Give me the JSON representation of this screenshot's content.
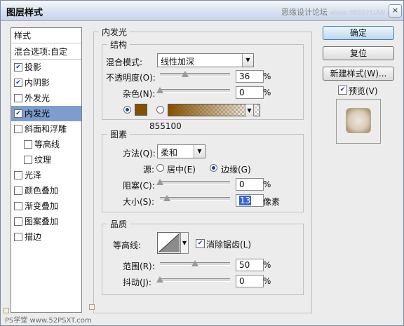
{
  "window": {
    "title": "图层样式",
    "close_glyph": "×"
  },
  "watermark": {
    "text": "思缘设计论坛",
    "site": "www.MISSYUAN.com"
  },
  "left_panel": {
    "header": "样式",
    "blend_options": "混合选项:自定",
    "items": [
      {
        "label": "投影",
        "checked": true
      },
      {
        "label": "内阴影",
        "checked": true
      },
      {
        "label": "外发光",
        "checked": false
      },
      {
        "label": "内发光",
        "checked": true,
        "selected": true
      },
      {
        "label": "斜面和浮雕",
        "checked": false
      },
      {
        "label": "等高线",
        "checked": false
      },
      {
        "label": "纹理",
        "checked": false
      },
      {
        "label": "光泽",
        "checked": false
      },
      {
        "label": "颜色叠加",
        "checked": false
      },
      {
        "label": "渐变叠加",
        "checked": false
      },
      {
        "label": "图案叠加",
        "checked": false
      },
      {
        "label": "描边",
        "checked": false
      }
    ]
  },
  "inner_glow": {
    "title": "内发光",
    "structure": {
      "title": "结构",
      "blend_mode_label": "混合模式:",
      "blend_mode_value": "线性加深",
      "opacity_label": "不透明度(O):",
      "opacity_value": "36",
      "opacity_level": 0.36,
      "noise_label": "杂色(N):",
      "noise_value": "0",
      "noise_level": 0,
      "percent_unit": "%",
      "glow_color": "#855100",
      "glow_color_text": "855100"
    },
    "elements": {
      "title": "图素",
      "technique_label": "方法(Q):",
      "technique_value": "柔和",
      "source_label": "源:",
      "source_center": "居中(E)",
      "source_edge": "边缘(G)",
      "choke_label": "阻塞(C):",
      "choke_value": "0",
      "choke_level": 0,
      "size_label": "大小(S):",
      "size_value": "13",
      "size_unit": "像素"
    },
    "quality": {
      "title": "品质",
      "contour_label": "等高线:",
      "anti_alias_label": "消除锯齿(L)",
      "range_label": "范围(R):",
      "range_value": "50",
      "range_level": 0.5,
      "jitter_label": "抖动(J):",
      "jitter_value": "0",
      "jitter_level": 0
    }
  },
  "buttons": {
    "ok": "确定",
    "reset": "复位",
    "new_style": "新建样式(W)...",
    "preview_label": "预览(V)"
  },
  "bottom_watermark": "PS学堂 www.52PSXT.com"
}
